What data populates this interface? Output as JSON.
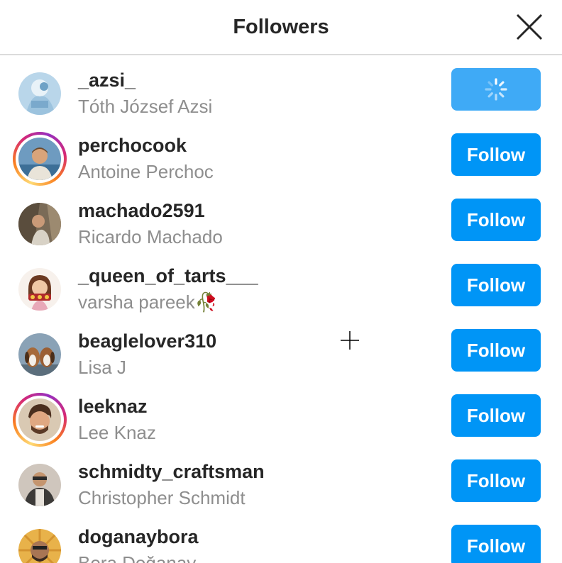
{
  "header": {
    "title": "Followers",
    "close_icon": "close-icon"
  },
  "followers": [
    {
      "username": "_azsi_",
      "full_name": "Tóth József Azsi",
      "button_label": "",
      "button_state": "loading",
      "story_ring": false
    },
    {
      "username": "perchocook",
      "full_name": "Antoine Perchoc",
      "button_label": "Follow",
      "button_state": "follow",
      "story_ring": true
    },
    {
      "username": "machado2591",
      "full_name": "Ricardo Machado",
      "button_label": "Follow",
      "button_state": "follow",
      "story_ring": false
    },
    {
      "username": "_queen_of_tarts___",
      "full_name": "varsha pareek🥀",
      "button_label": "Follow",
      "button_state": "follow",
      "story_ring": false
    },
    {
      "username": "beaglelover310",
      "full_name": "Lisa J",
      "button_label": "Follow",
      "button_state": "follow",
      "story_ring": false
    },
    {
      "username": "leeknaz",
      "full_name": "Lee Knaz",
      "button_label": "Follow",
      "button_state": "follow",
      "story_ring": true
    },
    {
      "username": "schmidty_craftsman",
      "full_name": "Christopher Schmidt",
      "button_label": "Follow",
      "button_state": "follow",
      "story_ring": false
    },
    {
      "username": "doganaybora",
      "full_name": "Bora Doğanay",
      "button_label": "Follow",
      "button_state": "follow",
      "story_ring": false
    }
  ],
  "colors": {
    "accent": "#0095f6",
    "accent_loading": "#3faaf6",
    "username": "#262626",
    "full_name": "#8e8e8e",
    "divider": "#dbdbdb",
    "story_ring": "#d62976"
  }
}
